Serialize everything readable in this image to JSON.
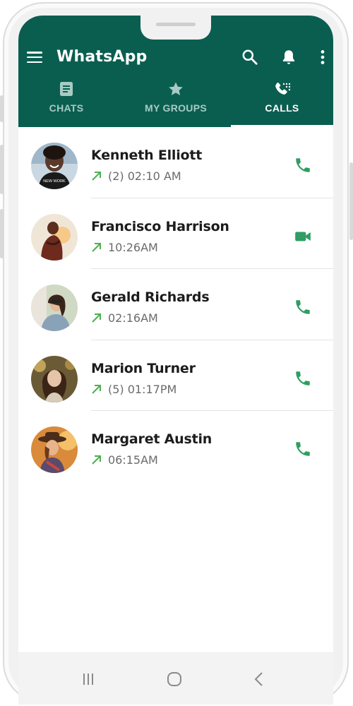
{
  "app": {
    "title": "WhatsApp"
  },
  "tabs": [
    {
      "label": "CHATS",
      "icon": "chat-document-icon",
      "active": false
    },
    {
      "label": "MY GROUPS",
      "icon": "star-icon",
      "active": false
    },
    {
      "label": "CALLS",
      "icon": "phone-dialpad-icon",
      "active": true
    }
  ],
  "colors": {
    "header": "#0a5e50",
    "accent": "#2e9e63",
    "inactive_tab": "#a7cbc4",
    "arrow": "#4caf50"
  },
  "calls": [
    {
      "name": "Kenneth Elliott",
      "detail": "(2) 02:10 AM",
      "direction": "outgoing",
      "type": "voice",
      "avatar_shirt_text": "NEW WORK"
    },
    {
      "name": "Francisco Harrison",
      "detail": "10:26AM",
      "direction": "outgoing",
      "type": "video"
    },
    {
      "name": "Gerald Richards",
      "detail": "02:16AM",
      "direction": "outgoing",
      "type": "voice"
    },
    {
      "name": "Marion Turner",
      "detail": "(5) 01:17PM",
      "direction": "outgoing",
      "type": "voice"
    },
    {
      "name": "Margaret Austin",
      "detail": "06:15AM",
      "direction": "outgoing",
      "type": "voice"
    }
  ],
  "navbar": {
    "buttons": [
      "recent-apps-icon",
      "home-icon",
      "back-icon"
    ]
  }
}
